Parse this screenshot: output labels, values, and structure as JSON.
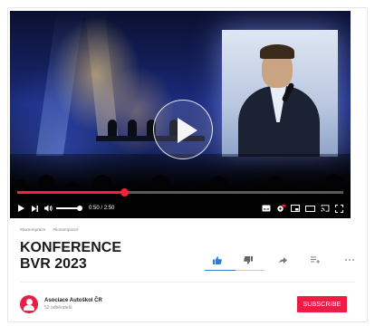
{
  "player": {
    "progress_fraction": 0.33,
    "volume_fraction": 1.0,
    "time_current": "0:50",
    "time_separator": "/",
    "time_total": "2:50",
    "colors": {
      "progress": "#ff1e3c"
    }
  },
  "video": {
    "tags": [
      "#konempraze",
      "#konempraze"
    ],
    "title_line1": "KONFERENCE",
    "title_line2": "BVR 2023"
  },
  "actions": {
    "icons": [
      "thumbs-up-icon",
      "thumbs-down-icon",
      "share-icon",
      "add-to-playlist-icon",
      "more-icon"
    ]
  },
  "channel": {
    "name": "Asociace Autoškol ČR",
    "subscribers": "52 odběratelů",
    "subscribe_label": "SUBSCRIBE",
    "colors": {
      "brand": "#ed1c45"
    }
  }
}
